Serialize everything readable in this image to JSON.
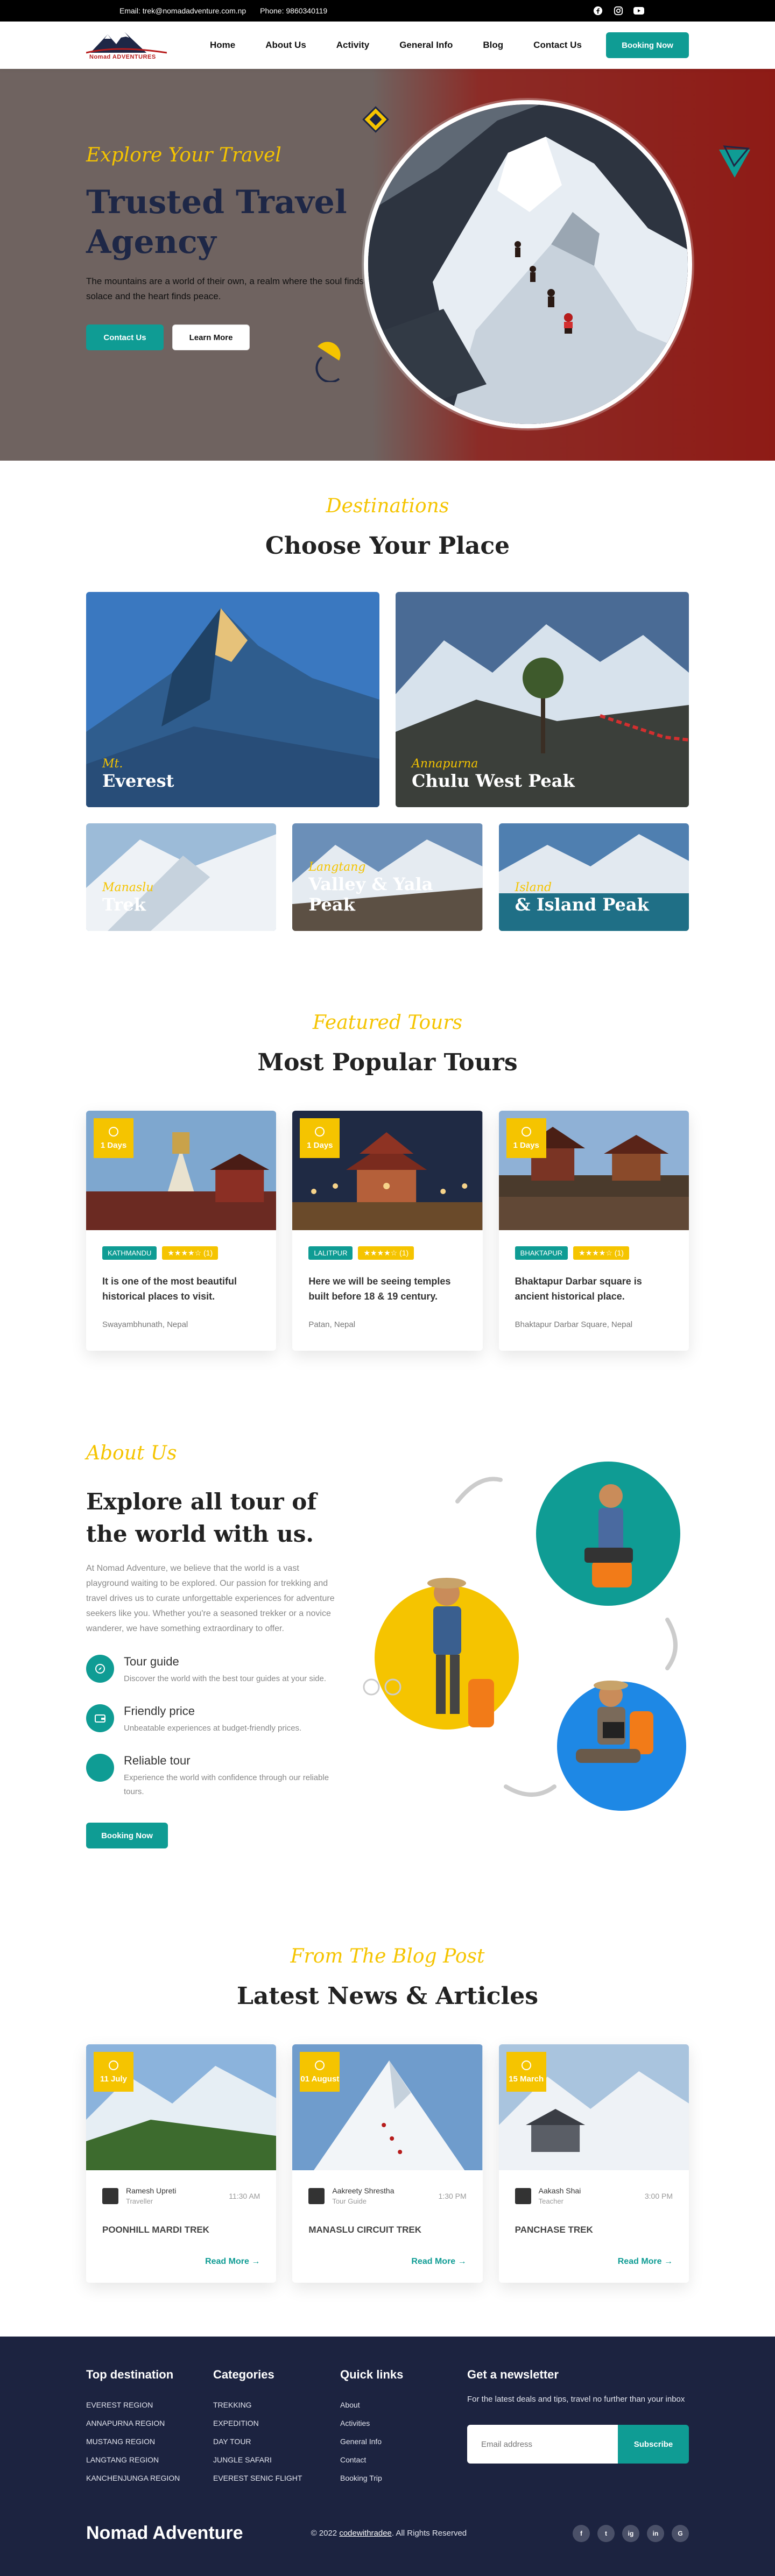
{
  "topbar": {
    "email": "Email: trek@nomadadventure.com.np",
    "phone": "Phone: 9860340119",
    "social": [
      "facebook-icon",
      "instagram-icon",
      "youtube-icon"
    ]
  },
  "nav": {
    "logo_text": "Nomad ADVENTURES",
    "items": [
      "Home",
      "About Us",
      "Activity",
      "General Info",
      "Blog",
      "Contact Us"
    ],
    "cta": "Booking Now"
  },
  "hero": {
    "script": "Explore Your Travel",
    "title": "Trusted Travel Agency",
    "desc": "The mountains are a world of their own, a realm where the soul finds solace and the heart finds peace.",
    "btn_contact": "Contact Us",
    "btn_learn": "Learn More"
  },
  "destinations": {
    "script": "Destinations",
    "title": "Choose Your Place",
    "cards": [
      {
        "script": "Mt.",
        "name": "Everest"
      },
      {
        "script": "Annapurna",
        "name": "Chulu West Peak"
      },
      {
        "script": "Manaslu",
        "name": "Trek"
      },
      {
        "script": "Langtang",
        "name": "Valley & Yala Peak"
      },
      {
        "script": "Island",
        "name": "& Island Peak"
      }
    ]
  },
  "tours": {
    "script": "Featured Tours",
    "title": "Most Popular Tours",
    "cards": [
      {
        "days": "1 Days",
        "location": "KATHMANDU",
        "stars": "★★★★☆ (1)",
        "title": "It is one of the most beautiful historical places to visit.",
        "place": "Swayambhunath, Nepal"
      },
      {
        "days": "1 Days",
        "location": "LALITPUR",
        "stars": "★★★★☆ (1)",
        "title": "Here we will be seeing temples built before 18 & 19 century.",
        "place": "Patan, Nepal"
      },
      {
        "days": "1 Days",
        "location": "BHAKTAPUR",
        "stars": "★★★★☆ (1)",
        "title": "Bhaktapur Darbar square is ancient historical place.",
        "place": "Bhaktapur Darbar Square, Nepal"
      }
    ]
  },
  "about": {
    "script": "About Us",
    "title": "Explore all tour of the world with us.",
    "lead": "At Nomad Adventure, we believe that the world is a vast playground waiting to be explored. Our passion for trekking and travel drives us to curate unforgettable experiences for adventure seekers like you. Whether you're a seasoned trekker or a novice wanderer, we have something extraordinary to offer.",
    "features": [
      {
        "title": "Tour guide",
        "desc": "Discover the world with the best tour guides at your side."
      },
      {
        "title": "Friendly price",
        "desc": "Unbeatable experiences at budget-friendly prices."
      },
      {
        "title": "Reliable tour",
        "desc": "Experience the world with confidence through our reliable tours."
      }
    ],
    "cta": "Booking Now"
  },
  "blog": {
    "script": "From The Blog Post",
    "title": "Latest News & Articles",
    "posts": [
      {
        "date": "11 July",
        "author": "Ramesh Upreti",
        "role": "Traveller",
        "time": "11:30 AM",
        "title": "POONHILL MARDI TREK",
        "read": "Read More"
      },
      {
        "date": "01 August",
        "author": "Aakreety Shrestha",
        "role": "Tour Guide",
        "time": "1:30 PM",
        "title": "MANASLU CIRCUIT TREK",
        "read": "Read More"
      },
      {
        "date": "15 March",
        "author": "Aakash Shai",
        "role": "Teacher",
        "time": "3:00 PM",
        "title": "PANCHASE TREK",
        "read": "Read More"
      }
    ]
  },
  "footer": {
    "cols": [
      {
        "title": "Top destination",
        "items": [
          "EVEREST REGION",
          "ANNAPURNA REGION",
          "MUSTANG REGION",
          "LANGTANG REGION",
          "KANCHENJUNGA REGION"
        ]
      },
      {
        "title": "Categories",
        "items": [
          "TREKKING",
          "EXPEDITION",
          "DAY TOUR",
          "JUNGLE SAFARI",
          "EVEREST SENIC FLIGHT"
        ]
      },
      {
        "title": "Quick links",
        "items": [
          "About",
          "Activities",
          "General Info",
          "Contact",
          "Booking Trip"
        ]
      }
    ],
    "newsletter_title": "Get a newsletter",
    "newsletter_desc": "For the latest deals and tips, travel no further than your inbox",
    "email_placeholder": "Email address",
    "subscribe": "Subscribe",
    "brand": "Nomad Adventure",
    "copy_prefix": "© 2022",
    "copy_link": "codewithradee",
    "copy_suffix": ". All Rights Reserved",
    "social": [
      "f",
      "t",
      "ig",
      "in",
      "G"
    ]
  },
  "colors": {
    "teal": "#0f9c94",
    "yellow": "#f5c400",
    "navy": "#1c2340",
    "hero_red": "#8e1b16"
  }
}
